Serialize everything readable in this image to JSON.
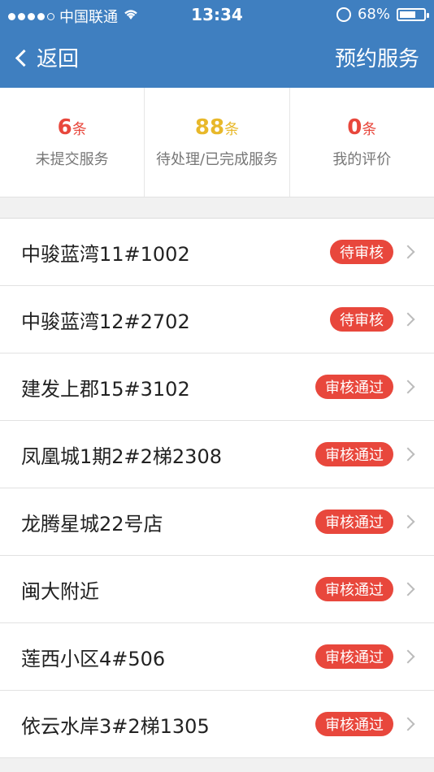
{
  "status_bar": {
    "carrier": "中国联通",
    "time": "13:34",
    "battery": "68%",
    "battery_level": 0.68
  },
  "nav": {
    "back_label": "返回",
    "right_label": "预约服务"
  },
  "stats": [
    {
      "num": "6",
      "unit": "条",
      "label": "未提交服务",
      "color": "#e8473c"
    },
    {
      "num": "88",
      "unit": "条",
      "label": "待处理/已完成服务",
      "color": "#e8b82a"
    },
    {
      "num": "0",
      "unit": "条",
      "label": "我的评价",
      "color": "#e8473c"
    }
  ],
  "list": [
    {
      "name": "中骏蓝湾11#1002",
      "status": "待审核"
    },
    {
      "name": "中骏蓝湾12#2702",
      "status": "待审核"
    },
    {
      "name": "建发上郡15#3102",
      "status": "审核通过"
    },
    {
      "name": "凤凰城1期2#2梯2308",
      "status": "审核通过"
    },
    {
      "name": "龙腾星城22号店",
      "status": "审核通过"
    },
    {
      "name": "闽大附近",
      "status": "审核通过"
    },
    {
      "name": "莲西小区4#506",
      "status": "审核通过"
    },
    {
      "name": "依云水岸3#2梯1305",
      "status": "审核通过"
    }
  ]
}
